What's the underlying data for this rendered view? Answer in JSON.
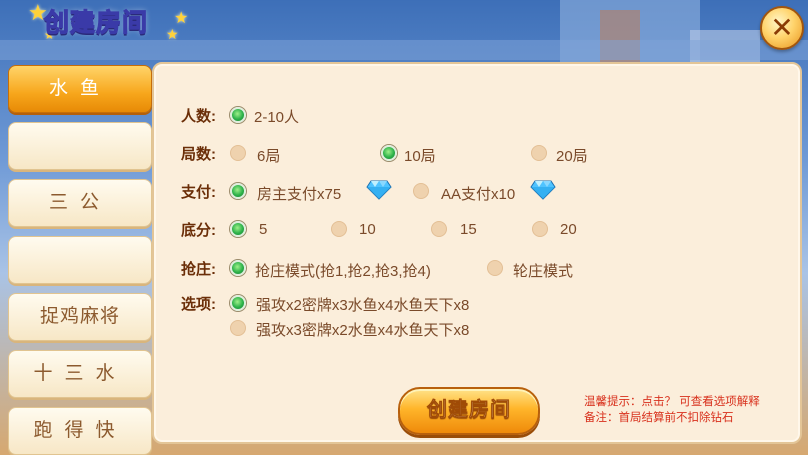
{
  "title": "创建房间",
  "close_icon": "close-icon",
  "sidebar": {
    "items": [
      {
        "label": "水鱼",
        "active": true
      },
      {
        "label": ""
      },
      {
        "label": "三公"
      },
      {
        "label": ""
      },
      {
        "label": "捉鸡麻将"
      },
      {
        "label": "十三水"
      },
      {
        "label": "跑得快"
      }
    ]
  },
  "form": {
    "players": {
      "label": "人数:",
      "options": [
        "2-10人"
      ],
      "selected": 0
    },
    "rounds": {
      "label": "局数:",
      "options": [
        "6局",
        "10局",
        "20局"
      ],
      "selected": 1
    },
    "payment": {
      "label": "支付:",
      "options": [
        "房主支付x75",
        "AA支付x10"
      ],
      "selected": 0,
      "icon": "diamond-icon"
    },
    "base_score": {
      "label": "底分:",
      "options": [
        "5",
        "10",
        "15",
        "20"
      ],
      "selected": 0
    },
    "banker": {
      "label": "抢庄:",
      "options": [
        "抢庄模式(抢1,抢2,抢3,抢4)",
        "轮庄模式"
      ],
      "selected": 0
    },
    "options": {
      "label": "选项:",
      "options": [
        "强攻x2密牌x3水鱼x4水鱼天下x8",
        "强攻x3密牌x2水鱼x4水鱼天下x8"
      ],
      "selected": 0
    }
  },
  "create_button": "创建房间",
  "hints": {
    "tip": "温馨提示：点击？ 可查看选项解释",
    "note": "备注：首局结算前不扣除钻石"
  },
  "colors": {
    "accent": "#f7a61b",
    "panel": "#fbeedb",
    "label": "#6b2e08",
    "radio_on": "#2db24a",
    "hint": "#d8301c"
  }
}
